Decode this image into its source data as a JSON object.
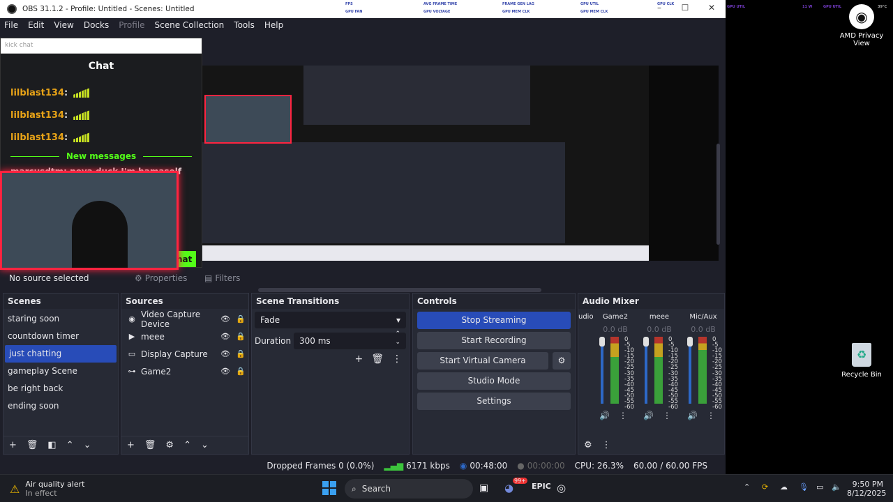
{
  "window": {
    "title": "OBS 31.1.2 - Profile: Untitled - Scenes: Untitled"
  },
  "perf_overlay": [
    "FPS",
    "AVG FRAME TIME",
    "FRAME GEN LAG",
    "GPU UTIL",
    "GPU FAN",
    "GPU VOLTAGE",
    "GPU MEM CLK",
    "GPU MEM CLK",
    "GPU CLK",
    "GPU UTIL",
    "GPU FAN",
    "11 W",
    "GPU UTIL",
    "39°C"
  ],
  "menu": [
    "File",
    "Edit",
    "View",
    "Docks",
    "Profile",
    "Scene Collection",
    "Tools",
    "Help"
  ],
  "chat": {
    "input_placeholder": "kick chat",
    "header": "Chat",
    "messages": [
      {
        "user": "lilblast134",
        "sep": ":"
      },
      {
        "user": "lilblast134",
        "sep": ":"
      },
      {
        "user": "lilblast134",
        "sep": ":"
      }
    ],
    "new_messages": "New messages",
    "partial_msg": "marcusdtm: peva duck I'm hamaself",
    "partial_button": "hat"
  },
  "source_bar": {
    "no_source": "No source selected",
    "properties": "Properties",
    "filters": "Filters"
  },
  "scenes": {
    "title": "Scenes",
    "items": [
      "staring soon",
      "countdown timer",
      "just chatting",
      "gameplay Scene",
      "be right back",
      "ending soon"
    ],
    "selected_index": 2
  },
  "sources": {
    "title": "Sources",
    "items": [
      {
        "label": "Video Capture Device",
        "icon": "camera-icon"
      },
      {
        "label": "meee",
        "icon": "play-icon"
      },
      {
        "label": "Display Capture",
        "icon": "monitor-icon"
      },
      {
        "label": "Game2",
        "icon": "gamepad-icon"
      }
    ]
  },
  "transitions": {
    "title": "Scene Transitions",
    "type": "Fade",
    "duration_label": "Duration",
    "duration_value": "300 ms"
  },
  "controls": {
    "title": "Controls",
    "stop_streaming": "Stop Streaming",
    "start_recording": "Start Recording",
    "start_virtual_camera": "Start Virtual Camera",
    "studio_mode": "Studio Mode",
    "settings": "Settings"
  },
  "mixer": {
    "title": "Audio Mixer",
    "partial_channel": "udio",
    "channels": [
      {
        "name": "Game2",
        "db": "0.0 dB"
      },
      {
        "name": "meee",
        "db": "0.0 dB"
      },
      {
        "name": "Mic/Aux",
        "db": "0.0 dB"
      }
    ],
    "scale": [
      "0",
      "-5",
      "-10",
      "-15",
      "-20",
      "-25",
      "-30",
      "-35",
      "-40",
      "-45",
      "-50",
      "-55",
      "-60"
    ]
  },
  "status": {
    "dropped_frames": "Dropped Frames 0 (0.0%)",
    "bitrate": "6171 kbps",
    "stream_time": "00:48:00",
    "rec_time": "00:00:00",
    "cpu": "CPU: 26.3%",
    "fps": "60.00 / 60.00 FPS"
  },
  "desktop": {
    "amd_label_1": "AMD Privacy",
    "amd_label_2": "View",
    "recycle_bin": "Recycle Bin"
  },
  "taskbar": {
    "weather_title": "Air quality alert",
    "weather_sub": "In effect",
    "search": "Search",
    "badge": "99+",
    "time": "9:50 PM",
    "date": "8/12/2025"
  },
  "colors": {
    "accent": "#284cb8",
    "chat_user": "#e8a317",
    "kick_green": "#53fc18",
    "cam_border": "#ff2440"
  }
}
